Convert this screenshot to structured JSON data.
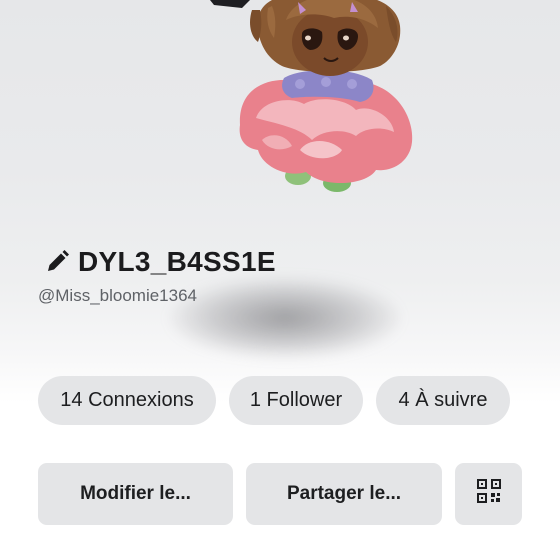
{
  "profile": {
    "display_name": "DYL3_B4SS1E",
    "username": "@Miss_bloomie1364",
    "edit_icon": "pencil-icon"
  },
  "stats": {
    "connexions": "14 Connexions",
    "followers": "1 Follower",
    "following": "4 À suivre"
  },
  "actions": {
    "edit_label": "Modifier le...",
    "share_label": "Partager le...",
    "qr_icon": "qr-code-icon"
  },
  "colors": {
    "chip_bg": "#e4e5e7",
    "text": "#1d1e20",
    "muted": "#5f6267"
  }
}
